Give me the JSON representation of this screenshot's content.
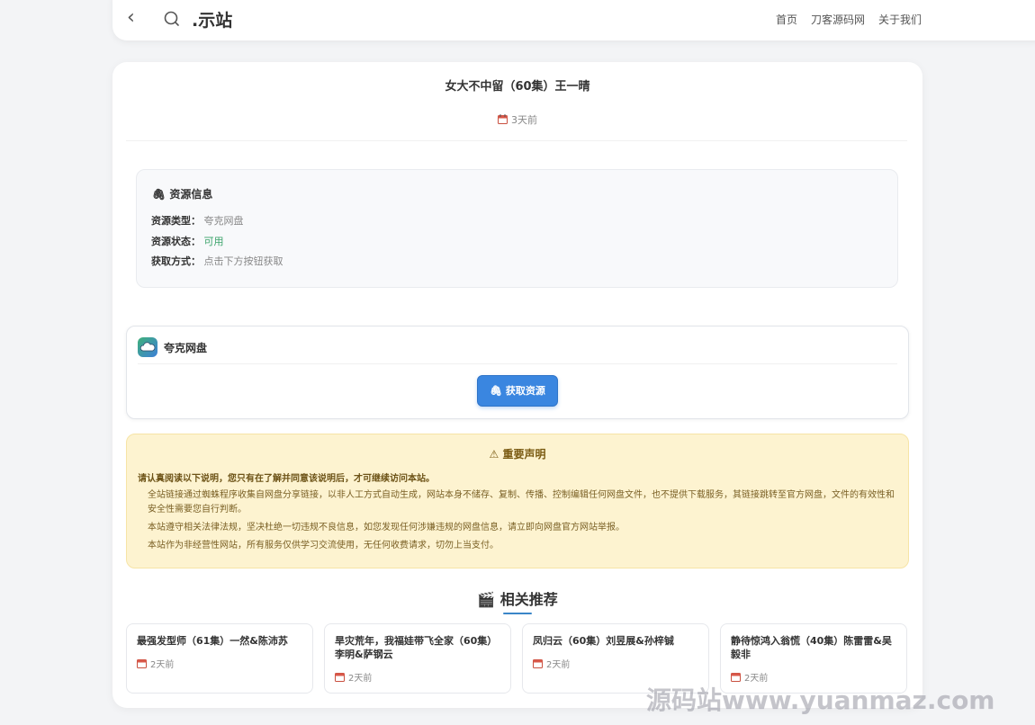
{
  "header": {
    "back_icon": "‹",
    "logo_text": ".示站",
    "nav": [
      "首页",
      "刀客源码网",
      "关于我们"
    ]
  },
  "post": {
    "title": "女大不中留（60集）王一晴",
    "date": "3天前"
  },
  "resource_info": {
    "heading": "资源信息",
    "rows": [
      {
        "label": "资源类型：",
        "value": "夸克网盘"
      },
      {
        "label": "资源状态：",
        "value": "可用"
      },
      {
        "label": "获取方式：",
        "value": "点击下方按钮获取"
      }
    ]
  },
  "pan": {
    "name": "夸克网盘",
    "button_label": "获取资源"
  },
  "notice": {
    "title": "重要声明",
    "lead": "请认真阅读以下说明，您只有在了解并同意该说明后，才可继续访问本站。",
    "items": [
      "全站链接通过蜘蛛程序收集自网盘分享链接，以非人工方式自动生成，网站本身不储存、复制、传播、控制编辑任何网盘文件，也不提供下载服务，其链接跳转至官方网盘，文件的有效性和安全性需要您自行判断。",
      "本站遵守相关法律法规，坚决杜绝一切违规不良信息，如您发现任何涉嫌违规的网盘信息，请立即向网盘官方网站举报。",
      "本站作为非经营性网站，所有服务仅供学习交流使用，无任何收费请求，切勿上当支付。"
    ]
  },
  "related": {
    "heading": "相关推荐",
    "items": [
      {
        "title": "最强发型师（61集）一然&陈沛苏",
        "date": "2天前"
      },
      {
        "title": "旱灾荒年，我福娃带飞全家（60集）李明&萨钢云",
        "date": "2天前"
      },
      {
        "title": "凤归云（60集）刘昱展&孙梓铖",
        "date": "2天前"
      },
      {
        "title": "静待惊鸿入翁慌（40集）陈雷雷&吴毅非",
        "date": "2天前"
      }
    ]
  },
  "watermark": "源码站www.yuanmaz.com",
  "colors": {
    "accent": "#3a86e0",
    "status_ok": "#3aa36a",
    "notice_bg": "#fdf3d0"
  }
}
